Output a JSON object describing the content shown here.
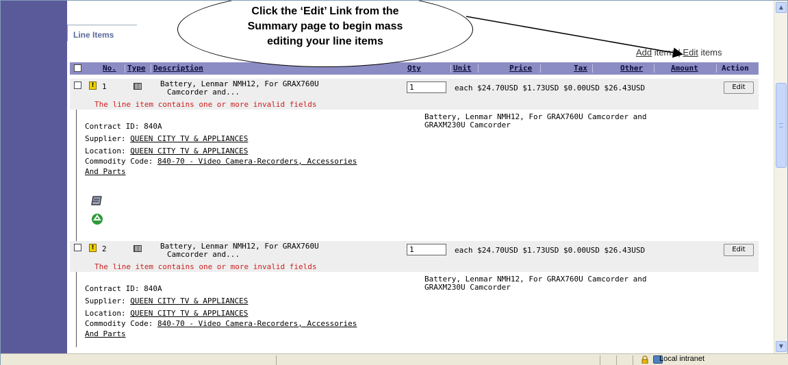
{
  "section_tab": "Line Items",
  "callout": {
    "line1": "Click the ‘Edit’ Link from the",
    "line2": "Summary page to begin mass",
    "line3": "editing your line items"
  },
  "links": {
    "add_link": "Add",
    "add_suffix": " items | ",
    "edit_link": "Edit",
    "edit_suffix": " items"
  },
  "columns": {
    "no": "No.",
    "type": "Type",
    "description": "Description",
    "qty": "Qty",
    "unit": "Unit",
    "price": "Price",
    "tax": "Tax",
    "other": "Other",
    "amount": "Amount",
    "action": "Action"
  },
  "rows": [
    {
      "no": "1",
      "desc_line1": "Battery, Lenmar NMH12, For GRAX760U",
      "desc_line2": "Camcorder and...",
      "qty": "1",
      "vals": "each $24.70USD $1.73USD $0.00USD $26.43USD",
      "edit": "Edit",
      "invalid": "The line item contains one or more invalid fields",
      "contract": "Contract ID: 840A",
      "supplier_label": "Supplier: ",
      "supplier": "QUEEN CITY TV & APPLIANCES",
      "location_label": "Location: ",
      "location": "QUEEN CITY TV & APPLIANCES",
      "commodity_label": "Commodity Code: ",
      "commodity_1": "840-70 - Video Camera-Recorders, Accessories",
      "commodity_2": "And Parts",
      "full_desc_1": "Battery, Lenmar NMH12, For GRAX760U Camcorder and",
      "full_desc_2": "GRAXM230U Camcorder"
    },
    {
      "no": "2",
      "desc_line1": "Battery, Lenmar NMH12, For GRAX760U",
      "desc_line2": "Camcorder and...",
      "qty": "1",
      "vals": "each $24.70USD $1.73USD $0.00USD $26.43USD",
      "edit": "Edit",
      "invalid": "The line item contains one or more invalid fields",
      "contract": "Contract ID: 840A",
      "supplier_label": "Supplier: ",
      "supplier": "QUEEN CITY TV & APPLIANCES",
      "location_label": "Location: ",
      "location": "QUEEN CITY TV & APPLIANCES",
      "commodity_label": "Commodity Code: ",
      "commodity_1": "840-70 - Video Camera-Recorders, Accessories",
      "commodity_2": "And Parts",
      "full_desc_1": "Battery, Lenmar NMH12, For GRAX760U Camcorder and",
      "full_desc_2": "GRAXM230U Camcorder"
    }
  ],
  "status": {
    "zone": "Local intranet"
  }
}
